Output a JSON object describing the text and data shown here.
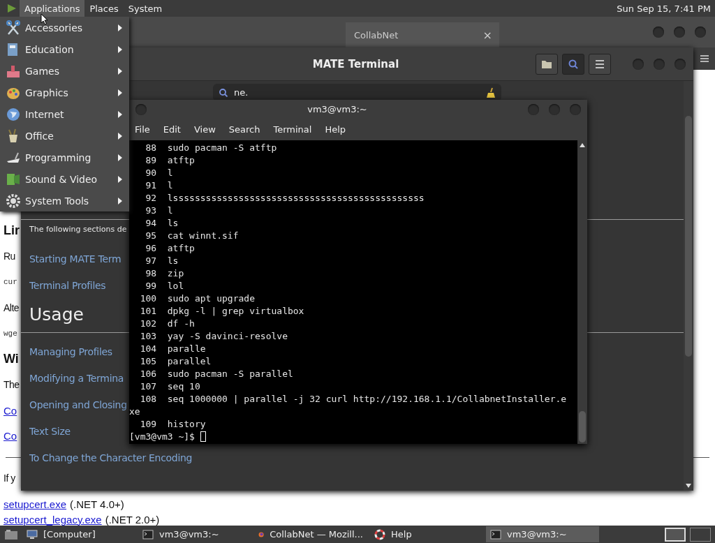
{
  "top_panel": {
    "menus": [
      {
        "label": "Applications",
        "selected": true
      },
      {
        "label": "Places",
        "selected": false
      },
      {
        "label": "System",
        "selected": false
      }
    ],
    "clock": "Sun Sep 15,  7:41 PM"
  },
  "browser": {
    "tab": {
      "title": "CollabNet",
      "close": "×"
    },
    "page": [
      {
        "kind": "heading",
        "text": "Lir"
      },
      {
        "kind": "text",
        "text": "Ru"
      },
      {
        "kind": "code",
        "text": "cur"
      },
      {
        "kind": "text",
        "text": "Alte"
      },
      {
        "kind": "code",
        "text": "wge"
      },
      {
        "kind": "heading",
        "text": "Wi"
      },
      {
        "kind": "text",
        "text": "The"
      },
      {
        "kind": "link",
        "text": "Co"
      },
      {
        "kind": "link",
        "text": "Co"
      },
      {
        "kind": "rule"
      },
      {
        "kind": "text",
        "text": "If y"
      }
    ],
    "downloads": [
      {
        "link": "setupcert.exe",
        "note": "(.NET 4.0+)"
      },
      {
        "link": "setupcert_legacy.exe",
        "note": "(.NET 2.0+)"
      }
    ]
  },
  "help_window": {
    "title": "MATE Terminal",
    "header_buttons": [
      {
        "kind": "folder",
        "selected": false
      },
      {
        "kind": "search",
        "selected": true
      },
      {
        "kind": "menu",
        "selected": false
      }
    ],
    "search": {
      "value": "ne."
    },
    "intro": "The following sections de",
    "sections": [
      {
        "links": [
          "Starting MATE Term",
          "Terminal Profiles"
        ]
      },
      {
        "heading": "Usage",
        "links": [
          "Managing Profiles",
          "Modifying a Termina",
          "Opening and Closing",
          "Text Size",
          "To Change the Character Encoding"
        ]
      }
    ]
  },
  "terminal": {
    "title": "vm3@vm3:~",
    "menu": [
      "File",
      "Edit",
      "View",
      "Search",
      "Terminal",
      "Help"
    ],
    "history": [
      {
        "number": "88",
        "command": "sudo pacman -S atftp"
      },
      {
        "number": "89",
        "command": "atftp"
      },
      {
        "number": "90",
        "command": "l"
      },
      {
        "number": "91",
        "command": "l"
      },
      {
        "number": "92",
        "command": "lssssssssssssssssssssssssssssssssssssssssssssss"
      },
      {
        "number": "93",
        "command": "l"
      },
      {
        "number": "94",
        "command": "ls"
      },
      {
        "number": "95",
        "command": "cat winnt.sif"
      },
      {
        "number": "96",
        "command": "atftp"
      },
      {
        "number": "97",
        "command": "ls"
      },
      {
        "number": "98",
        "command": "zip"
      },
      {
        "number": "99",
        "command": "lol"
      },
      {
        "number": "100",
        "command": "sudo apt upgrade"
      },
      {
        "number": "101",
        "command": "dpkg -l | grep virtualbox"
      },
      {
        "number": "102",
        "command": "df -h"
      },
      {
        "number": "103",
        "command": "yay -S davinci-resolve"
      },
      {
        "number": "104",
        "command": "paralle"
      },
      {
        "number": "105",
        "command": "parallel"
      },
      {
        "number": "106",
        "command": "sudo pacman -S parallel"
      },
      {
        "number": "107",
        "command": "seq 10"
      },
      {
        "number": "108",
        "command": "seq 1000000 | parallel -j 32 curl http://192.168.1.1/CollabnetInstaller.exe"
      },
      {
        "number": "109",
        "command": "history"
      }
    ],
    "prompt": "[vm3@vm3 ~]$"
  },
  "applications_menu": {
    "items": [
      {
        "label": "Accessories"
      },
      {
        "label": "Education"
      },
      {
        "label": "Games"
      },
      {
        "label": "Graphics"
      },
      {
        "label": "Internet"
      },
      {
        "label": "Office"
      },
      {
        "label": "Programming"
      },
      {
        "label": "Sound & Video"
      },
      {
        "label": "System Tools"
      }
    ]
  },
  "taskbar": {
    "items": [
      {
        "kind": "file-manager",
        "label": "[Computer]",
        "selected": false
      },
      {
        "kind": "terminal",
        "label": "vm3@vm3:~",
        "selected": false
      },
      {
        "kind": "browser",
        "label": "CollabNet — Mozill...",
        "selected": false
      },
      {
        "kind": "help",
        "label": "Help",
        "selected": false
      },
      {
        "kind": "terminal",
        "label": "vm3@vm3:~",
        "selected": true
      }
    ]
  }
}
